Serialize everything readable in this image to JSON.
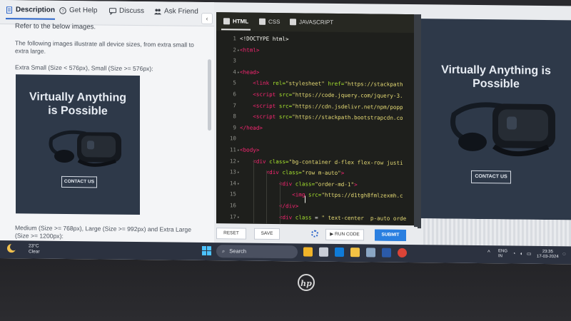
{
  "left_panel": {
    "tabs": [
      {
        "label": "Description",
        "icon": "document-icon",
        "active": true
      },
      {
        "label": "Get Help",
        "icon": "help-icon",
        "active": false
      },
      {
        "label": "Discuss",
        "icon": "chat-icon",
        "active": false
      },
      {
        "label": "Ask Friend",
        "icon": "people-icon",
        "active": false
      }
    ],
    "collapse_glyph": "‹",
    "heading": "Refer to the below images.",
    "para1": "The following images illustrate all device sizes, from extra small to",
    "para1_cont": "extra large.",
    "small_label": "Extra Small (Size < 576px), Small (Size >= 576px):",
    "ad_title_line1": "Virtually Anything",
    "ad_title_line2": "is Possible",
    "ad_button": "CONTACT US",
    "medium_label": "Medium (Size >= 768px), Large (Size >= 992px) and Extra Large",
    "medium_label_cont": "(Size >= 1200px):"
  },
  "editor": {
    "tabs": [
      {
        "label": "HTML",
        "active": true
      },
      {
        "label": "CSS",
        "active": false
      },
      {
        "label": "JAVASCRIPT",
        "active": false
      }
    ],
    "lines": [
      {
        "n": "1",
        "fold": false,
        "segments": [
          {
            "c": "pl",
            "t": "<!DOCTYPE html>"
          }
        ]
      },
      {
        "n": "2",
        "fold": true,
        "segments": [
          {
            "c": "tag",
            "t": "<html>"
          }
        ]
      },
      {
        "n": "3",
        "fold": false,
        "segments": []
      },
      {
        "n": "4",
        "fold": true,
        "segments": [
          {
            "c": "tag",
            "t": "<head>"
          }
        ]
      },
      {
        "n": "5",
        "fold": false,
        "segments": [
          {
            "c": "pl",
            "t": "    "
          },
          {
            "c": "tag",
            "t": "<link"
          },
          {
            "c": "attr",
            "t": " rel="
          },
          {
            "c": "str",
            "t": "\"stylesheet\""
          },
          {
            "c": "attr",
            "t": " href="
          },
          {
            "c": "str",
            "t": "\"https://stackpath"
          }
        ]
      },
      {
        "n": "6",
        "fold": false,
        "segments": [
          {
            "c": "pl",
            "t": "    "
          },
          {
            "c": "tag",
            "t": "<script"
          },
          {
            "c": "attr",
            "t": " src="
          },
          {
            "c": "str",
            "t": "\"https://code.jquery.com/jquery-3."
          }
        ]
      },
      {
        "n": "7",
        "fold": false,
        "segments": [
          {
            "c": "pl",
            "t": "    "
          },
          {
            "c": "tag",
            "t": "<script"
          },
          {
            "c": "attr",
            "t": " src="
          },
          {
            "c": "str",
            "t": "\"https://cdn.jsdelivr.net/npm/popp"
          }
        ]
      },
      {
        "n": "8",
        "fold": false,
        "segments": [
          {
            "c": "pl",
            "t": "    "
          },
          {
            "c": "tag",
            "t": "<script"
          },
          {
            "c": "attr",
            "t": " src="
          },
          {
            "c": "str",
            "t": "\"https://stackpath.bootstrapcdn.co"
          }
        ]
      },
      {
        "n": "9",
        "fold": false,
        "segments": [
          {
            "c": "tag",
            "t": "</head>"
          }
        ]
      },
      {
        "n": "10",
        "fold": false,
        "segments": []
      },
      {
        "n": "11",
        "fold": true,
        "segments": [
          {
            "c": "tag",
            "t": "<body>"
          }
        ]
      },
      {
        "n": "12",
        "fold": true,
        "segments": [
          {
            "c": "pl",
            "t": "    "
          },
          {
            "c": "tag",
            "t": "<div"
          },
          {
            "c": "attr",
            "t": " class="
          },
          {
            "c": "str",
            "t": "\"bg-container d-flex flex-row justi"
          }
        ]
      },
      {
        "n": "13",
        "fold": true,
        "segments": [
          {
            "c": "pl",
            "t": "        "
          },
          {
            "c": "tag",
            "t": "<div"
          },
          {
            "c": "attr",
            "t": " class="
          },
          {
            "c": "str",
            "t": "\"row m-auto\""
          },
          {
            "c": "tag",
            "t": ">"
          }
        ]
      },
      {
        "n": "14",
        "fold": true,
        "segments": [
          {
            "c": "pl",
            "t": "            "
          },
          {
            "c": "tag",
            "t": "<div"
          },
          {
            "c": "attr",
            "t": " class="
          },
          {
            "c": "str",
            "t": "\"order-md-1\""
          },
          {
            "c": "tag",
            "t": ">"
          }
        ]
      },
      {
        "n": "15",
        "fold": false,
        "segments": [
          {
            "c": "pl",
            "t": "                "
          },
          {
            "c": "tag",
            "t": "<img"
          },
          {
            "c": "attr",
            "t": " src="
          },
          {
            "c": "str",
            "t": "\"https://d1tgh8fmlzexmh.c"
          }
        ]
      },
      {
        "n": "16",
        "fold": false,
        "segments": [
          {
            "c": "pl",
            "t": "            "
          },
          {
            "c": "tag",
            "t": "</div>"
          }
        ]
      },
      {
        "n": "17",
        "fold": true,
        "segments": [
          {
            "c": "pl",
            "t": "            "
          },
          {
            "c": "tag",
            "t": "<div"
          },
          {
            "c": "attr",
            "t": " class"
          },
          {
            "c": "pl",
            "t": " = "
          },
          {
            "c": "str",
            "t": "\" text-center  p-auto orde"
          }
        ]
      }
    ]
  },
  "toolbar": {
    "reset_label": "RESET",
    "save_label": "SAVE",
    "run_label": "▶ RUN CODE",
    "submit_label": "SUBMIT"
  },
  "preview": {
    "title_line1": "Virtually Anything is",
    "title_line2": "Possible",
    "button": "CONTACT US"
  },
  "taskbar": {
    "weather_temp": "23°C",
    "weather_desc": "Clear",
    "search_placeholder": "Search",
    "lang_line1": "ENG",
    "lang_line2": "IN",
    "time": "23:35",
    "date": "17-03-2024"
  },
  "laptop": {
    "brand": "hp"
  },
  "colors": {
    "accent": "#2a7fe0",
    "editor_bg": "#1e1f1c",
    "banner_bg": "#2e3949"
  }
}
